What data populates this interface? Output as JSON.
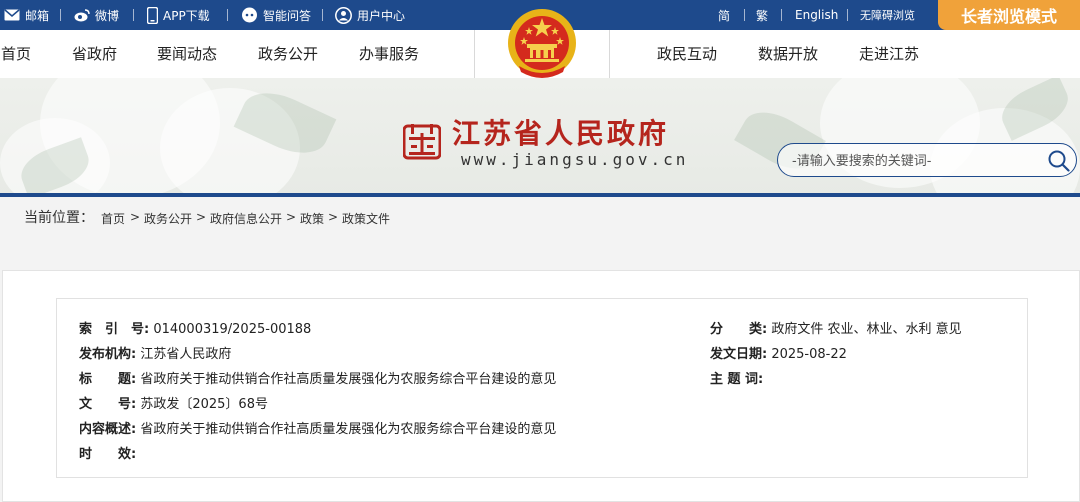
{
  "topbar": {
    "mail": "邮箱",
    "weibo": "微博",
    "app": "APP下载",
    "qa": "智能问答",
    "user": "用户中心",
    "simplified": "简",
    "traditional": "繁",
    "english": "English",
    "accessible": "无障碍浏览",
    "elder_mode": "长者浏览模式"
  },
  "nav": {
    "home": "首页",
    "province_gov": "省政府",
    "news": "要闻动态",
    "open_gov": "政务公开",
    "service": "办事服务",
    "interaction": "政民互动",
    "open_data": "数据开放",
    "about": "走进江苏"
  },
  "site": {
    "name": "江苏省人民政府",
    "url": "www.jiangsu.gov.cn"
  },
  "search": {
    "placeholder": "-请输入要搜索的关键词-"
  },
  "breadcrumb": {
    "label": "当前位置：",
    "items": [
      "首页",
      "政务公开",
      "政府信息公开",
      "政策",
      "政策文件"
    ],
    "separator": ">"
  },
  "doc_info": {
    "index_label": "索　引　号:",
    "index_value": "014000319/2025-00188",
    "category_label": "分　　类:",
    "category_value": "政府文件 农业、林业、水利 意见",
    "publisher_label": "发布机构:",
    "publisher_value": "江苏省人民政府",
    "date_label": "发文日期:",
    "date_value": "2025-08-22",
    "title_label": "标　　题:",
    "title_value": "省政府关于推动供销合作社高质量发展强化为农服务综合平台建设的意见",
    "subject_label": "主 题 词:",
    "subject_value": "",
    "doc_no_label": "文　　号:",
    "doc_no_value": "苏政发〔2025〕68号",
    "summary_label": "内容概述:",
    "summary_value": "省政府关于推动供销合作社高质量发展强化为农服务综合平台建设的意见",
    "validity_label": "时　　效:",
    "validity_value": ""
  },
  "colors": {
    "primary": "#1e4a8c",
    "accent": "#f0a23a",
    "brand_red": "#b5251d"
  }
}
